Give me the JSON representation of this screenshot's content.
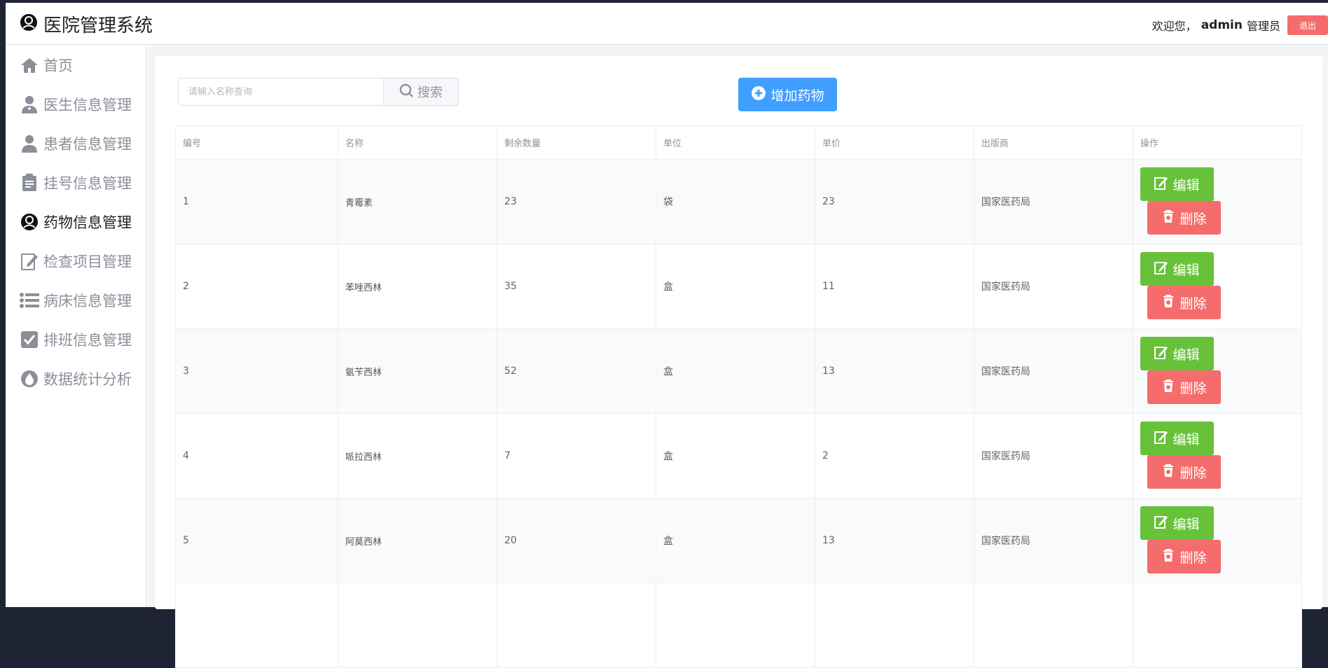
{
  "app": {
    "title": "医院管理系统",
    "welcome": "欢迎您，",
    "user": "admin",
    "role": "管理员",
    "logout": "退出"
  },
  "sidebar": {
    "items": [
      {
        "label": "首页",
        "icon": "home-icon"
      },
      {
        "label": "医生信息管理",
        "icon": "doctor-icon"
      },
      {
        "label": "患者信息管理",
        "icon": "patient-icon"
      },
      {
        "label": "挂号信息管理",
        "icon": "clipboard-icon"
      },
      {
        "label": "药物信息管理",
        "icon": "medicine-icon",
        "active": true
      },
      {
        "label": "检查项目管理",
        "icon": "edit-doc-icon"
      },
      {
        "label": "病床信息管理",
        "icon": "list-icon"
      },
      {
        "label": "排班信息管理",
        "icon": "check-square-icon"
      },
      {
        "label": "数据统计分析",
        "icon": "drop-icon"
      }
    ]
  },
  "toolbar": {
    "search_placeholder": "请输入名称查询",
    "search_label": "搜索",
    "add_label": "增加药物"
  },
  "table": {
    "headers": [
      "编号",
      "名称",
      "剩余数量",
      "单位",
      "单价",
      "出版商",
      "操作"
    ],
    "rows": [
      {
        "id": "1",
        "name": "青霉素",
        "qty": "23",
        "unit": "袋",
        "price": "23",
        "publisher": "国家医药局"
      },
      {
        "id": "2",
        "name": "苯唑西林",
        "qty": "35",
        "unit": "盒",
        "price": "11",
        "publisher": "国家医药局"
      },
      {
        "id": "3",
        "name": "氨苄西林",
        "qty": "52",
        "unit": "盒",
        "price": "13",
        "publisher": "国家医药局"
      },
      {
        "id": "4",
        "name": "哌拉西林",
        "qty": "7",
        "unit": "盒",
        "price": "2",
        "publisher": "国家医药局"
      },
      {
        "id": "5",
        "name": "阿莫西林",
        "qty": "20",
        "unit": "盒",
        "price": "13",
        "publisher": "国家医药局"
      }
    ],
    "edit_label": "编辑",
    "delete_label": "删除"
  },
  "colors": {
    "primary": "#409eff",
    "success": "#67c23a",
    "danger": "#f56c6c"
  }
}
